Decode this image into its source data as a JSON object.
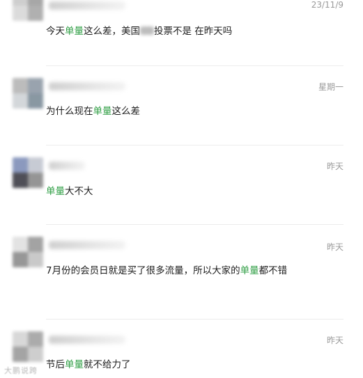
{
  "comments": [
    {
      "timestamp": "23/11/9",
      "parts": [
        {
          "text": "今天",
          "hl": false
        },
        {
          "text": "单量",
          "hl": true
        },
        {
          "text": "这么差，美国",
          "hl": false
        },
        {
          "redacted": true
        },
        {
          "text": "投票不是 在昨天吗",
          "hl": false
        }
      ]
    },
    {
      "timestamp": "星期一",
      "parts": [
        {
          "text": "为什么现在",
          "hl": false
        },
        {
          "text": "单量",
          "hl": true
        },
        {
          "text": "这么差",
          "hl": false
        }
      ]
    },
    {
      "timestamp": "昨天",
      "parts": [
        {
          "text": "单量",
          "hl": true
        },
        {
          "text": "大不大",
          "hl": false
        }
      ]
    },
    {
      "timestamp": "昨天",
      "parts": [
        {
          "text": "7月份的会员日就是买了很多流量，所以大家的",
          "hl": false
        },
        {
          "text": "单量",
          "hl": true
        },
        {
          "text": "都不错",
          "hl": false
        }
      ]
    },
    {
      "timestamp": "昨天",
      "parts": [
        {
          "text": "节后",
          "hl": false
        },
        {
          "text": "单量",
          "hl": true
        },
        {
          "text": "就不给力了",
          "hl": false
        }
      ]
    }
  ],
  "watermark": "大鹏说跨",
  "colors": {
    "highlight": "#2f9e44",
    "timestamp": "#9a9a9a",
    "text": "#1b1b1b",
    "divider": "#ececec"
  }
}
